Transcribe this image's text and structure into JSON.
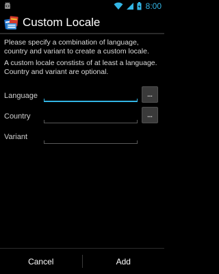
{
  "status_bar": {
    "left_icon": "android-debug-icon",
    "time": "8:00",
    "icons": [
      "wifi-icon",
      "signal-icon",
      "battery-icon"
    ],
    "accent_color": "#33b5e5"
  },
  "action_bar": {
    "app_icon": "locale-flags-icon",
    "title": "Custom Locale"
  },
  "content": {
    "description_1": "Please specify a combination of language, country and variant to create a custom locale.",
    "description_2": "A custom locale constists of at least a language. Country and variant are optional.",
    "fields": [
      {
        "label": "Language",
        "value": "",
        "focused": true,
        "has_picker": true,
        "picker_label": "..."
      },
      {
        "label": "Country",
        "value": "",
        "focused": false,
        "has_picker": true,
        "picker_label": "..."
      },
      {
        "label": "Variant",
        "value": "",
        "focused": false,
        "has_picker": false
      }
    ]
  },
  "buttons": {
    "cancel": "Cancel",
    "add": "Add"
  }
}
